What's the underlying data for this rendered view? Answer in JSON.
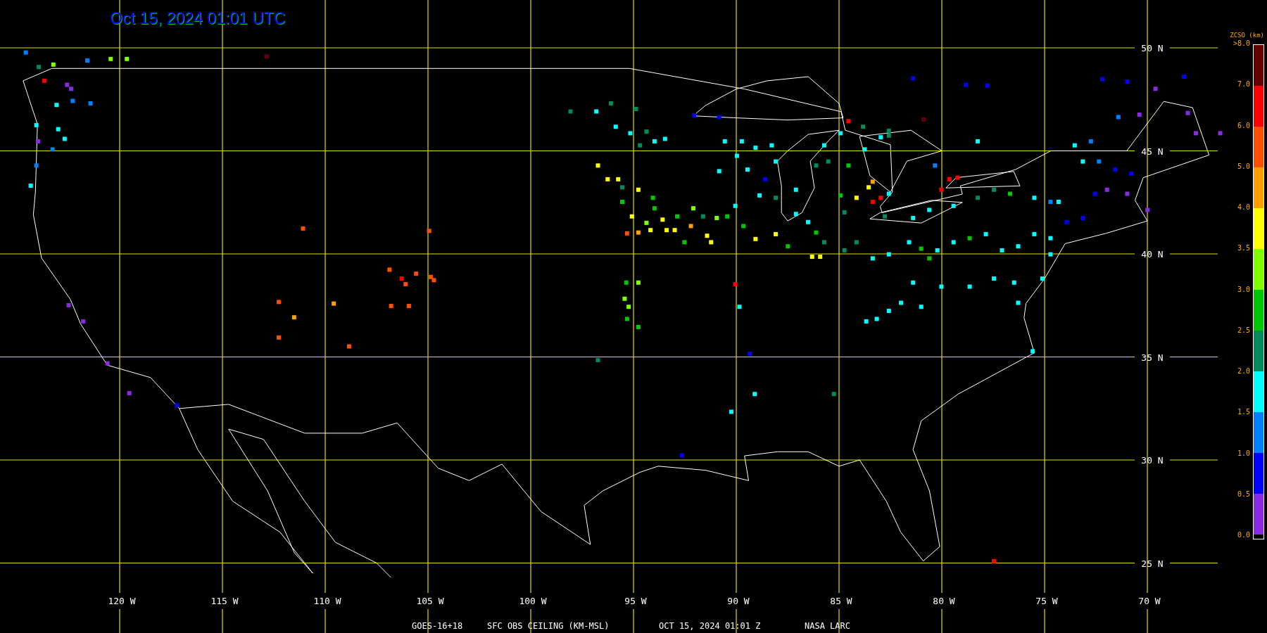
{
  "title": "Oct 15, 2024 01:01 UTC",
  "map": {
    "latitude_labels": [
      "50 N",
      "45 N",
      "40 N",
      "35 N",
      "30 N",
      "25 N"
    ],
    "longitude_labels": [
      "120 W",
      "115 W",
      "110 W",
      "105 W",
      "100 W",
      "95 W",
      "90 W",
      "85 W",
      "80 W",
      "75 W",
      "70 W"
    ]
  },
  "caption": [
    "GOES-16+18",
    "SFC OBS CEILING (KM-MSL)",
    "OCT 15, 2024 01:01 Z",
    "NASA LARC"
  ],
  "legend": {
    "title": "ZCSO (km)",
    "labels": [
      ">8.0",
      "7.0",
      "6.0",
      "5.0",
      "4.0",
      "3.5",
      "3.0",
      "2.5",
      "2.0",
      "1.5",
      "1.0",
      "0.5",
      "0.0"
    ],
    "bands": [
      {
        "color": "#660000"
      },
      {
        "color": "#ff0000"
      },
      {
        "color": "#ff5000"
      },
      {
        "color": "#ffa000"
      },
      {
        "color": "#ffff00"
      },
      {
        "color": "#80ff00"
      },
      {
        "color": "#00c800"
      },
      {
        "color": "#008c5a"
      },
      {
        "color": "#00ffff"
      },
      {
        "color": "#0080ff"
      },
      {
        "color": "#0000ff"
      },
      {
        "color": "#8a2be2"
      }
    ]
  }
}
